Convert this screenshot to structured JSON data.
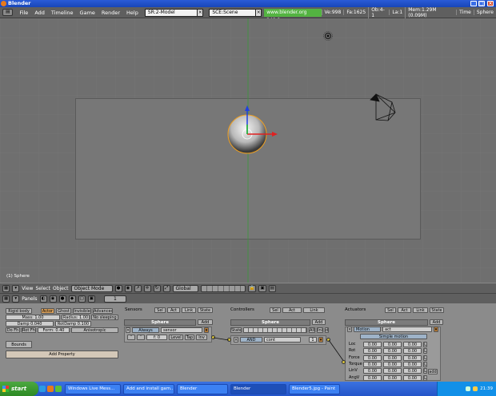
{
  "window": {
    "title": "Blender"
  },
  "menubar": {
    "items": [
      "File",
      "Add",
      "Timeline",
      "Game",
      "Render",
      "Help"
    ],
    "screen_field": "SR:2-Model",
    "scene_field": "SCE:Scene",
    "url": "www.blender.org 249.2",
    "stats": [
      "Ve:998",
      "Fa:1625",
      "Ob:4-1",
      "La:1",
      "Mem:1.29M (0.09M)",
      "Time",
      "Sphere"
    ]
  },
  "viewport": {
    "label": "(1) Sphere"
  },
  "viewport_toolbar": {
    "menus": [
      "View",
      "Select",
      "Object"
    ],
    "mode": "Object Mode",
    "orientation": "Global"
  },
  "logic_header": {
    "panels_label": "Panels",
    "frame": "1"
  },
  "physics": {
    "tabs": [
      "Rigid body",
      "Actor",
      "Ghost",
      "Invisible",
      "Advanced"
    ],
    "mass": "Mass: 1.00",
    "radius": "Radius: 1.00",
    "no_sleeping": "No sleeping",
    "damp": "Damp 0.040",
    "rotdamp": "RotDamp 0.100",
    "do_fh": "Do Fh",
    "rot_fh": "Rot Fh",
    "form": "Form: 0.40",
    "anisotropic": "Anisotropic",
    "bounds": "Bounds",
    "add_property": "Add Property"
  },
  "sensors": {
    "label": "Sensors",
    "tabs": [
      "Sel",
      "Act",
      "Link",
      "State"
    ],
    "object": "Sphere",
    "add": "Add",
    "type": "Always",
    "name": "sensor",
    "freq": "f: 0",
    "level": "Level",
    "tap": "Tap",
    "inv": "Inv"
  },
  "controllers": {
    "label": "Controllers",
    "tabs": [
      "Sel",
      "Act",
      "Link"
    ],
    "object": "Sphere",
    "add": "Add",
    "state": "State",
    "all": "All",
    "ini": "Ini",
    "type": "AND",
    "name": "cont",
    "num": "1"
  },
  "actuators": {
    "label": "Actuators",
    "tabs": [
      "Sel",
      "Act",
      "Link",
      "State"
    ],
    "object": "Sphere",
    "add": "Add",
    "type": "Motion",
    "name": "act",
    "mode": "Simple motion",
    "rows": [
      "Loc",
      "Rot",
      "Force",
      "Torque",
      "LinV",
      "AngV"
    ],
    "value": "0.00",
    "add_toggle": "add"
  },
  "taskbar": {
    "start": "start",
    "tasks": [
      "Windows Live Mess...",
      "Add and install gam...",
      "Blender",
      "Blender",
      "Blender5.jpg - Paint"
    ],
    "clock": "21:39"
  },
  "colors": {
    "x_axis": "#e02020",
    "y_axis": "#20c020",
    "z_axis": "#2040e0",
    "viewport_bg": "#6f6f6f",
    "selected_orange": "#d9a05b"
  }
}
